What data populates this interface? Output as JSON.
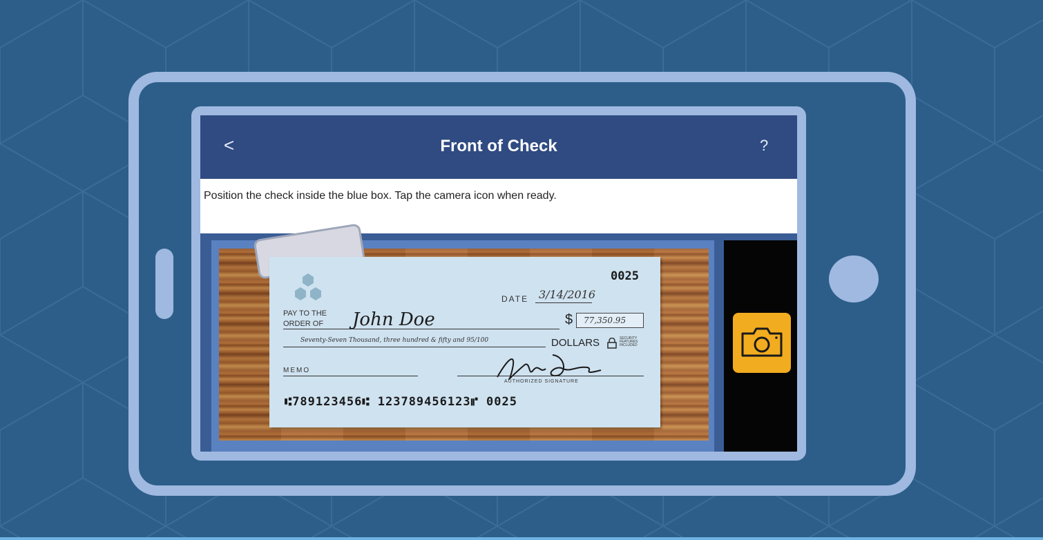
{
  "header": {
    "back_label": "<",
    "title": "Front of Check",
    "help_label": "?"
  },
  "instruction": "Position the check inside the blue box. Tap the camera icon when ready.",
  "check": {
    "number": "0025",
    "date_label": "DATE",
    "date_value": "3/14/2016",
    "pay_to_label_line1": "PAY TO THE",
    "pay_to_label_line2": "ORDER OF",
    "payee": "John Doe",
    "dollar_sign": "$",
    "amount": "77,350.95",
    "written_amount": "Seventy-Seven Thousand, three hundred & fifty and 95/100",
    "dollars_label": "DOLLARS",
    "security_text": "SECURITY FEATURES INCLUDED",
    "memo_label": "MEMO",
    "auth_sig_label": "AUTHORIZED SIGNATURE",
    "micr_line": "⑆789123456⑆ 123789456123⑈ 0025"
  },
  "colors": {
    "background": "#2d5e8a",
    "phone_frame": "#9fb9e0",
    "header_bar": "#2f4b82",
    "camera_button": "#f2ac1f",
    "check_paper": "#cfe2f0"
  },
  "icons": {
    "camera": "camera-icon",
    "lock": "lock-icon",
    "logo": "hexagon-logo-icon"
  }
}
